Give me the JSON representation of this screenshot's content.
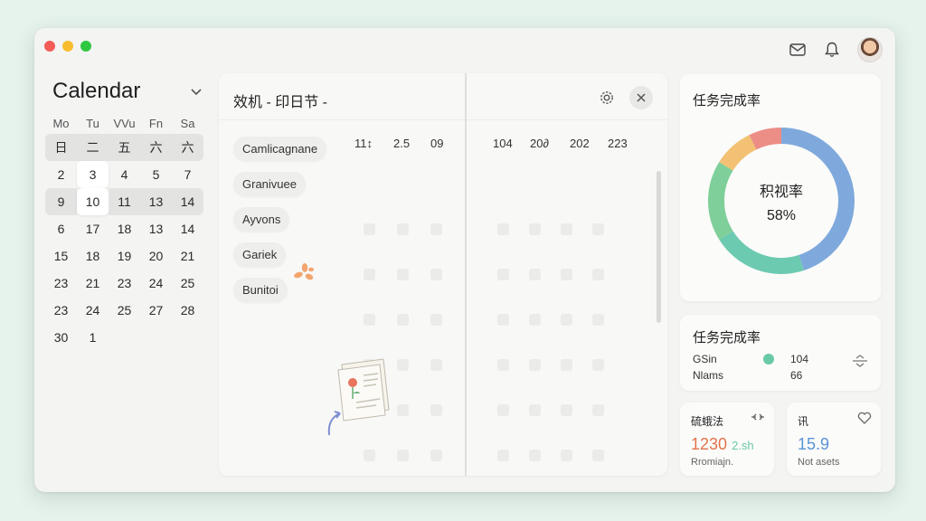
{
  "window": {
    "controls": [
      "close",
      "minimize",
      "maximize"
    ]
  },
  "topbar": {
    "icons": [
      "mail-icon",
      "bell-icon"
    ],
    "avatar": "user-avatar"
  },
  "calendar": {
    "title": "Calendar",
    "weekdays": [
      "Mo",
      "Tu",
      "VVu",
      "Fn",
      "Sa"
    ],
    "rows": [
      [
        "日",
        "二",
        "五",
        "六",
        "六"
      ],
      [
        "2",
        "3",
        "4",
        "5",
        "7"
      ],
      [
        "9",
        "10",
        "11",
        "13",
        "14"
      ],
      [
        "6",
        "17",
        "18",
        "13",
        "14"
      ],
      [
        "15",
        "18",
        "19",
        "20",
        "21"
      ],
      [
        "23",
        "21",
        "23",
        "24",
        "25"
      ],
      [
        "23",
        "24",
        "25",
        "27",
        "28"
      ],
      [
        "30",
        "1",
        "",
        "",
        ""
      ]
    ],
    "selected": [
      "3",
      "10"
    ]
  },
  "main": {
    "title": "效机 - 印日节 -",
    "tags": [
      "Camlicagnane",
      "Granivuee",
      "Ayvons",
      "Gariek",
      "Bunitoi"
    ],
    "left_numbers": [
      "11↕",
      "2.5",
      "09"
    ],
    "right_numbers": [
      "104",
      "20∂",
      "202",
      "223"
    ]
  },
  "donut_card": {
    "title": "任务完成率",
    "center_label": "积视率",
    "center_value": "58%",
    "segment_colors": [
      "#7fa9dc",
      "#6ccab0",
      "#7fcf9a",
      "#f2c173",
      "#ec8e86"
    ]
  },
  "stats_card": {
    "title": "任务完成率",
    "label1": "GSin",
    "label2": "Nlams",
    "value1": "104",
    "value2": "66"
  },
  "mini_cards": [
    {
      "title": "硫蛾法",
      "value": "1230",
      "unit": "2.sh",
      "sub": "Rromiajn.",
      "color": "#e4734a"
    },
    {
      "title": "讯",
      "value": "15.9",
      "unit": "",
      "sub": "Not asets",
      "color": "#5a93d5"
    }
  ]
}
